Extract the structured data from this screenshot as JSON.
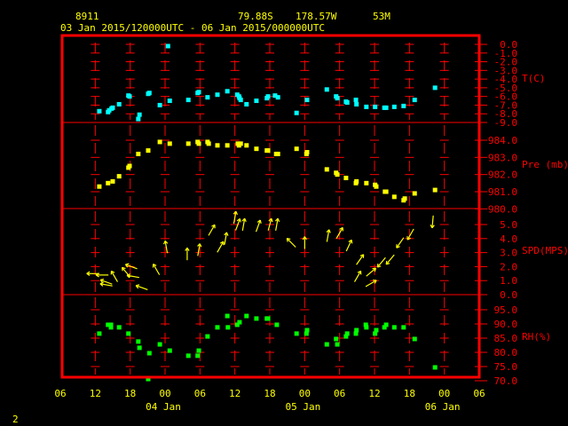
{
  "header": {
    "station": "8911",
    "lat": "79.88S",
    "lon": "178.57W",
    "elev": "53M",
    "period": "03 Jan 2015/120000UTC - 06 Jan 2015/000000UTC"
  },
  "footer_number": "2",
  "colors": {
    "frame": "#ff0000",
    "text": "#ffff00",
    "axis_text": "#ff0000",
    "temp": "#00ffff",
    "pres": "#ffff00",
    "wind": "#ffff00",
    "rh": "#00ff00"
  },
  "chart_data": {
    "type": "scatter",
    "title": "8911 79.88S 178.57W 53M",
    "subtitle": "03 Jan 2015/120000UTC - 06 Jan 2015/000000UTC",
    "x_units": "hours since 03 Jan 2015 06UTC",
    "xlim": [
      0,
      72
    ],
    "x_ticks": [
      {
        "h": 0,
        "label": "06"
      },
      {
        "h": 6,
        "label": "12"
      },
      {
        "h": 12,
        "label": "18"
      },
      {
        "h": 18,
        "label": "00"
      },
      {
        "h": 24,
        "label": "06"
      },
      {
        "h": 30,
        "label": "12"
      },
      {
        "h": 36,
        "label": "18"
      },
      {
        "h": 42,
        "label": "00"
      },
      {
        "h": 48,
        "label": "06"
      },
      {
        "h": 54,
        "label": "12"
      },
      {
        "h": 60,
        "label": "18"
      },
      {
        "h": 66,
        "label": "00"
      },
      {
        "h": 72,
        "label": "06"
      }
    ],
    "date_labels": [
      {
        "h": 18,
        "label": "04 Jan"
      },
      {
        "h": 42,
        "label": "05 Jan"
      },
      {
        "h": 66,
        "label": "06 Jan"
      }
    ],
    "grid": true,
    "panels": [
      {
        "name": "temperature",
        "ylabel": "T(C)",
        "ylim": [
          -9,
          0
        ],
        "marker": "square",
        "ticks": [
          "0.0",
          "-1.0",
          "-2.0",
          "-3.0",
          "-4.0",
          "-5.0",
          "-6.0",
          "-7.0",
          "-8.0",
          "-9.0"
        ],
        "tick_values": [
          0,
          -1,
          -2,
          -3,
          -4,
          -5,
          -6,
          -7,
          -8,
          -9
        ],
        "points": [
          [
            6.7,
            -7.7
          ],
          [
            8.2,
            -7.8
          ],
          [
            8.4,
            -7.6
          ],
          [
            8.8,
            -7.4
          ],
          [
            9.0,
            -7.3
          ],
          [
            10.1,
            -6.9
          ],
          [
            11.7,
            -5.9
          ],
          [
            11.9,
            -6.0
          ],
          [
            13.4,
            -8.6
          ],
          [
            13.6,
            -8.1
          ],
          [
            15.1,
            -5.7
          ],
          [
            15.3,
            -5.6
          ],
          [
            17.1,
            -7.0
          ],
          [
            18.5,
            -0.2
          ],
          [
            18.8,
            -6.5
          ],
          [
            22.0,
            -6.4
          ],
          [
            23.6,
            -5.6
          ],
          [
            23.8,
            -5.5
          ],
          [
            25.3,
            -6.1
          ],
          [
            27.0,
            -5.8
          ],
          [
            28.7,
            -5.4
          ],
          [
            30.4,
            -5.8
          ],
          [
            30.7,
            -6.0
          ],
          [
            30.8,
            -6.2
          ],
          [
            31.0,
            -6.4
          ],
          [
            32.0,
            -6.9
          ],
          [
            33.7,
            -6.5
          ],
          [
            35.5,
            -6.2
          ],
          [
            35.7,
            -6.0
          ],
          [
            36.9,
            -5.9
          ],
          [
            37.4,
            -6.1
          ],
          [
            40.6,
            -7.9
          ],
          [
            42.4,
            -6.4
          ],
          [
            45.8,
            -5.2
          ],
          [
            47.4,
            -6.0
          ],
          [
            47.6,
            -6.2
          ],
          [
            49.1,
            -6.6
          ],
          [
            49.3,
            -6.7
          ],
          [
            50.8,
            -6.4
          ],
          [
            50.9,
            -6.9
          ],
          [
            52.6,
            -7.2
          ],
          [
            54.1,
            -7.2
          ],
          [
            55.7,
            -7.3
          ],
          [
            56.0,
            -7.3
          ],
          [
            57.4,
            -7.2
          ],
          [
            59.0,
            -7.1
          ],
          [
            60.9,
            -6.4
          ],
          [
            64.4,
            -5.0
          ]
        ]
      },
      {
        "name": "pressure",
        "ylabel": "Pre (mb)",
        "ylim": [
          980,
          984.9
        ],
        "marker": "square",
        "ticks": [
          "984.0",
          "983.0",
          "982.0",
          "981.0",
          "980.0"
        ],
        "tick_values": [
          984,
          983,
          982,
          981,
          980
        ],
        "points": [
          [
            6.7,
            981.3
          ],
          [
            8.2,
            981.5
          ],
          [
            9.0,
            981.6
          ],
          [
            10.1,
            981.9
          ],
          [
            11.7,
            982.4
          ],
          [
            11.9,
            982.5
          ],
          [
            13.4,
            983.2
          ],
          [
            15.1,
            983.4
          ],
          [
            17.1,
            983.9
          ],
          [
            18.8,
            983.8
          ],
          [
            22.0,
            983.8
          ],
          [
            23.6,
            983.9
          ],
          [
            23.8,
            983.8
          ],
          [
            25.3,
            983.9
          ],
          [
            25.5,
            983.8
          ],
          [
            27.0,
            983.7
          ],
          [
            28.7,
            983.7
          ],
          [
            30.5,
            983.8
          ],
          [
            30.7,
            983.7
          ],
          [
            31.0,
            983.8
          ],
          [
            32.0,
            983.7
          ],
          [
            33.7,
            983.5
          ],
          [
            35.5,
            983.4
          ],
          [
            35.7,
            983.4
          ],
          [
            37.1,
            983.2
          ],
          [
            37.4,
            983.2
          ],
          [
            40.6,
            983.5
          ],
          [
            42.3,
            983.2
          ],
          [
            42.4,
            983.3
          ],
          [
            45.8,
            982.3
          ],
          [
            47.4,
            982.1
          ],
          [
            47.6,
            982.0
          ],
          [
            49.1,
            981.8
          ],
          [
            50.8,
            981.5
          ],
          [
            50.9,
            981.6
          ],
          [
            52.6,
            981.5
          ],
          [
            54.1,
            981.4
          ],
          [
            54.3,
            981.3
          ],
          [
            55.8,
            981.0
          ],
          [
            56.0,
            981.0
          ],
          [
            57.4,
            980.7
          ],
          [
            59.0,
            980.5
          ],
          [
            59.2,
            980.6
          ],
          [
            60.9,
            980.9
          ],
          [
            64.4,
            981.1
          ]
        ]
      },
      {
        "name": "wind",
        "ylabel": "SPD(MPS)",
        "ylim": [
          0,
          6.1
        ],
        "marker": "arrow",
        "ticks": [
          "5.0",
          "4.0",
          "3.0",
          "2.0",
          "1.0",
          "0.0"
        ],
        "tick_values": [
          5,
          4,
          3,
          2,
          1,
          0
        ],
        "points_note": "[hour, speed, arrow direction degrees clockwise from up]",
        "points": [
          [
            5.6,
            1.5,
            270
          ],
          [
            7.2,
            1.4,
            270
          ],
          [
            7.9,
            0.9,
            290
          ],
          [
            7.9,
            0.7,
            280
          ],
          [
            9.3,
            1.3,
            330
          ],
          [
            11.3,
            1.6,
            320
          ],
          [
            12.2,
            2.0,
            290
          ],
          [
            12.5,
            1.3,
            280
          ],
          [
            14.0,
            0.5,
            290
          ],
          [
            16.5,
            1.8,
            330
          ],
          [
            18.2,
            3.4,
            350
          ],
          [
            21.8,
            2.9,
            0
          ],
          [
            23.8,
            3.2,
            10
          ],
          [
            26.0,
            4.6,
            30
          ],
          [
            27.5,
            3.4,
            30
          ],
          [
            28.4,
            4.0,
            10
          ],
          [
            30.0,
            5.5,
            10
          ],
          [
            30.5,
            5.0,
            20
          ],
          [
            31.5,
            5.0,
            10
          ],
          [
            34.0,
            4.9,
            20
          ],
          [
            36.0,
            5.0,
            15
          ],
          [
            37.2,
            5.0,
            10
          ],
          [
            39.7,
            3.7,
            315
          ],
          [
            42.0,
            3.7,
            0
          ],
          [
            46.0,
            4.2,
            10
          ],
          [
            48.0,
            4.4,
            30
          ],
          [
            49.6,
            3.5,
            25
          ],
          [
            51.5,
            2.5,
            35
          ],
          [
            51.1,
            1.3,
            30
          ],
          [
            53.4,
            1.6,
            50
          ],
          [
            53.4,
            0.8,
            60
          ],
          [
            55.2,
            2.3,
            220
          ],
          [
            56.7,
            2.5,
            220
          ],
          [
            58.4,
            3.7,
            215
          ],
          [
            60.2,
            4.3,
            210
          ],
          [
            64.0,
            5.2,
            185
          ]
        ]
      },
      {
        "name": "relative-humidity",
        "ylabel": "RH(%)",
        "ylim": [
          70,
          100
        ],
        "marker": "square",
        "ticks": [
          "95.0",
          "90.0",
          "85.0",
          "80.0",
          "75.0",
          "70.0"
        ],
        "tick_values": [
          95,
          90,
          85,
          80,
          75,
          70
        ],
        "points": [
          [
            6.7,
            86.6
          ],
          [
            8.2,
            89.7
          ],
          [
            8.7,
            89.7
          ],
          [
            8.7,
            88.8
          ],
          [
            10.1,
            88.8
          ],
          [
            11.7,
            86.6
          ],
          [
            13.4,
            83.8
          ],
          [
            13.6,
            81.6
          ],
          [
            15.3,
            79.7
          ],
          [
            15.1,
            70.6
          ],
          [
            17.1,
            82.8
          ],
          [
            18.8,
            80.6
          ],
          [
            22.0,
            78.8
          ],
          [
            23.6,
            78.8
          ],
          [
            23.8,
            80.6
          ],
          [
            25.3,
            85.6
          ],
          [
            27.0,
            88.8
          ],
          [
            28.7,
            92.8
          ],
          [
            28.8,
            88.8
          ],
          [
            30.4,
            89.7
          ],
          [
            30.8,
            90.6
          ],
          [
            32.0,
            92.8
          ],
          [
            33.7,
            91.9
          ],
          [
            35.5,
            91.9
          ],
          [
            35.7,
            91.9
          ],
          [
            37.2,
            89.7
          ],
          [
            40.6,
            86.6
          ],
          [
            42.3,
            86.6
          ],
          [
            42.4,
            87.8
          ],
          [
            45.8,
            82.8
          ],
          [
            47.4,
            84.7
          ],
          [
            47.6,
            82.8
          ],
          [
            49.1,
            85.6
          ],
          [
            49.3,
            86.6
          ],
          [
            50.8,
            86.6
          ],
          [
            50.9,
            87.8
          ],
          [
            52.5,
            89.7
          ],
          [
            52.6,
            88.8
          ],
          [
            54.1,
            86.6
          ],
          [
            54.3,
            87.8
          ],
          [
            55.7,
            88.8
          ],
          [
            56.0,
            89.7
          ],
          [
            57.4,
            88.8
          ],
          [
            59.0,
            88.8
          ],
          [
            60.9,
            84.7
          ],
          [
            64.4,
            74.7
          ]
        ]
      }
    ]
  }
}
